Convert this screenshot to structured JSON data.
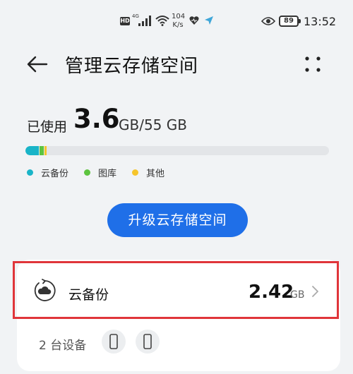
{
  "status_bar": {
    "hd": "HD",
    "network": "4G",
    "speed_value": "104",
    "speed_unit": "K/s",
    "battery": "89",
    "time": "13:52"
  },
  "header": {
    "title": "管理云存储空间"
  },
  "storage": {
    "used_label": "已使用",
    "used_value": "3.6",
    "used_total": "GB/55 GB",
    "usage_fractions": {
      "cloud_backup": 0.044,
      "gallery": 0.014,
      "other": 0.007
    },
    "legend": [
      {
        "label": "云备份",
        "color": "#19b4c8"
      },
      {
        "label": "图库",
        "color": "#5dc43f"
      },
      {
        "label": "其他",
        "color": "#f6c52b"
      }
    ]
  },
  "upgrade_button": "升级云存储空间",
  "backup_item": {
    "label": "云备份",
    "size": "2.42",
    "unit": "GB"
  },
  "devices": {
    "label": "2 台设备"
  }
}
